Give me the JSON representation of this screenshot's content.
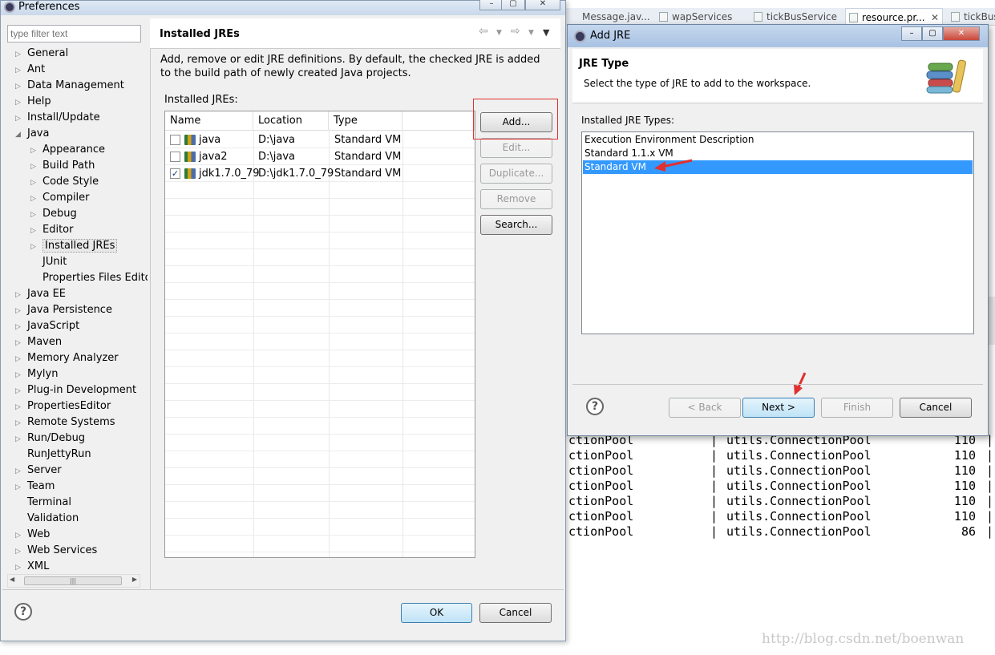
{
  "editor_tabs": [
    "Message.jav...",
    "wapServices",
    "tickBusService",
    "resource.pr...",
    "tickBus"
  ],
  "console_rows": [
    {
      "left": "ctionPool",
      "sep": "|",
      "right": "utils.ConnectionPool",
      "num": "110",
      "end": "|"
    },
    {
      "left": "ctionPool",
      "sep": "|",
      "right": "utils.ConnectionPool",
      "num": "110",
      "end": "|"
    },
    {
      "left": "ctionPool",
      "sep": "|",
      "right": "utils.ConnectionPool",
      "num": "110",
      "end": "|"
    },
    {
      "left": "ctionPool",
      "sep": "|",
      "right": "utils.ConnectionPool",
      "num": "110",
      "end": "|"
    },
    {
      "left": "ctionPool",
      "sep": "|",
      "right": "utils.ConnectionPool",
      "num": "110",
      "end": "|"
    },
    {
      "left": "ctionPool",
      "sep": "|",
      "right": "utils.ConnectionPool",
      "num": "110",
      "end": "|"
    },
    {
      "left": "ctionPool",
      "sep": "|",
      "right": "utils.ConnectionPool",
      "num": "86",
      "end": "|"
    }
  ],
  "watermark": "http://blog.csdn.net/boenwan",
  "preferences": {
    "title": "Preferences",
    "filter_placeholder": "type filter text",
    "tree": [
      {
        "label": "General",
        "level": 0,
        "arrow": "▷"
      },
      {
        "label": "Ant",
        "level": 0,
        "arrow": "▷"
      },
      {
        "label": "Data Management",
        "level": 0,
        "arrow": "▷"
      },
      {
        "label": "Help",
        "level": 0,
        "arrow": "▷"
      },
      {
        "label": "Install/Update",
        "level": 0,
        "arrow": "▷"
      },
      {
        "label": "Java",
        "level": 0,
        "arrow": "◢"
      },
      {
        "label": "Appearance",
        "level": 1,
        "arrow": "▷"
      },
      {
        "label": "Build Path",
        "level": 1,
        "arrow": "▷"
      },
      {
        "label": "Code Style",
        "level": 1,
        "arrow": "▷"
      },
      {
        "label": "Compiler",
        "level": 1,
        "arrow": "▷"
      },
      {
        "label": "Debug",
        "level": 1,
        "arrow": "▷"
      },
      {
        "label": "Editor",
        "level": 1,
        "arrow": "▷"
      },
      {
        "label": "Installed JREs",
        "level": 1,
        "arrow": "▷",
        "selected": true
      },
      {
        "label": "JUnit",
        "level": 1,
        "arrow": ""
      },
      {
        "label": "Properties Files Edito",
        "level": 1,
        "arrow": ""
      },
      {
        "label": "Java EE",
        "level": 0,
        "arrow": "▷"
      },
      {
        "label": "Java Persistence",
        "level": 0,
        "arrow": "▷"
      },
      {
        "label": "JavaScript",
        "level": 0,
        "arrow": "▷"
      },
      {
        "label": "Maven",
        "level": 0,
        "arrow": "▷"
      },
      {
        "label": "Memory Analyzer",
        "level": 0,
        "arrow": "▷"
      },
      {
        "label": "Mylyn",
        "level": 0,
        "arrow": "▷"
      },
      {
        "label": "Plug-in Development",
        "level": 0,
        "arrow": "▷"
      },
      {
        "label": "PropertiesEditor",
        "level": 0,
        "arrow": "▷"
      },
      {
        "label": "Remote Systems",
        "level": 0,
        "arrow": "▷"
      },
      {
        "label": "Run/Debug",
        "level": 0,
        "arrow": "▷"
      },
      {
        "label": "RunJettyRun",
        "level": 0,
        "arrow": ""
      },
      {
        "label": "Server",
        "level": 0,
        "arrow": "▷"
      },
      {
        "label": "Team",
        "level": 0,
        "arrow": "▷"
      },
      {
        "label": "Terminal",
        "level": 0,
        "arrow": ""
      },
      {
        "label": "Validation",
        "level": 0,
        "arrow": ""
      },
      {
        "label": "Web",
        "level": 0,
        "arrow": "▷"
      },
      {
        "label": "Web Services",
        "level": 0,
        "arrow": "▷"
      },
      {
        "label": "XML",
        "level": 0,
        "arrow": "▷"
      }
    ],
    "page_title": "Installed JREs",
    "description": "Add, remove or edit JRE definitions. By default, the checked JRE is added to the build path of newly created Java projects.",
    "installed_label": "Installed JREs:",
    "columns": [
      "Name",
      "Location",
      "Type"
    ],
    "jres": [
      {
        "name": "java",
        "location": "D:\\java",
        "type": "Standard VM",
        "checked": false
      },
      {
        "name": "java2",
        "location": "D:\\java",
        "type": "Standard VM",
        "checked": false
      },
      {
        "name": "jdk1.7.0_79",
        "location": "D:\\jdk1.7.0_79",
        "type": "Standard VM",
        "checked": true
      }
    ],
    "buttons": {
      "add": "Add...",
      "edit": "Edit...",
      "duplicate": "Duplicate...",
      "remove": "Remove",
      "search": "Search..."
    },
    "ok": "OK",
    "cancel": "Cancel",
    "help": "?"
  },
  "add_jre": {
    "title": "Add JRE",
    "header_title": "JRE Type",
    "header_desc": "Select the type of JRE to add to the workspace.",
    "types_label": "Installed JRE Types:",
    "types": [
      "Execution Environment Description",
      "Standard 1.1.x VM",
      "Standard VM"
    ],
    "selected_index": 2,
    "back": "< Back",
    "next": "Next >",
    "finish": "Finish",
    "cancel": "Cancel",
    "help": "?"
  },
  "colors": {
    "selection": "#3399ff",
    "annotation_red": "#e03030"
  }
}
